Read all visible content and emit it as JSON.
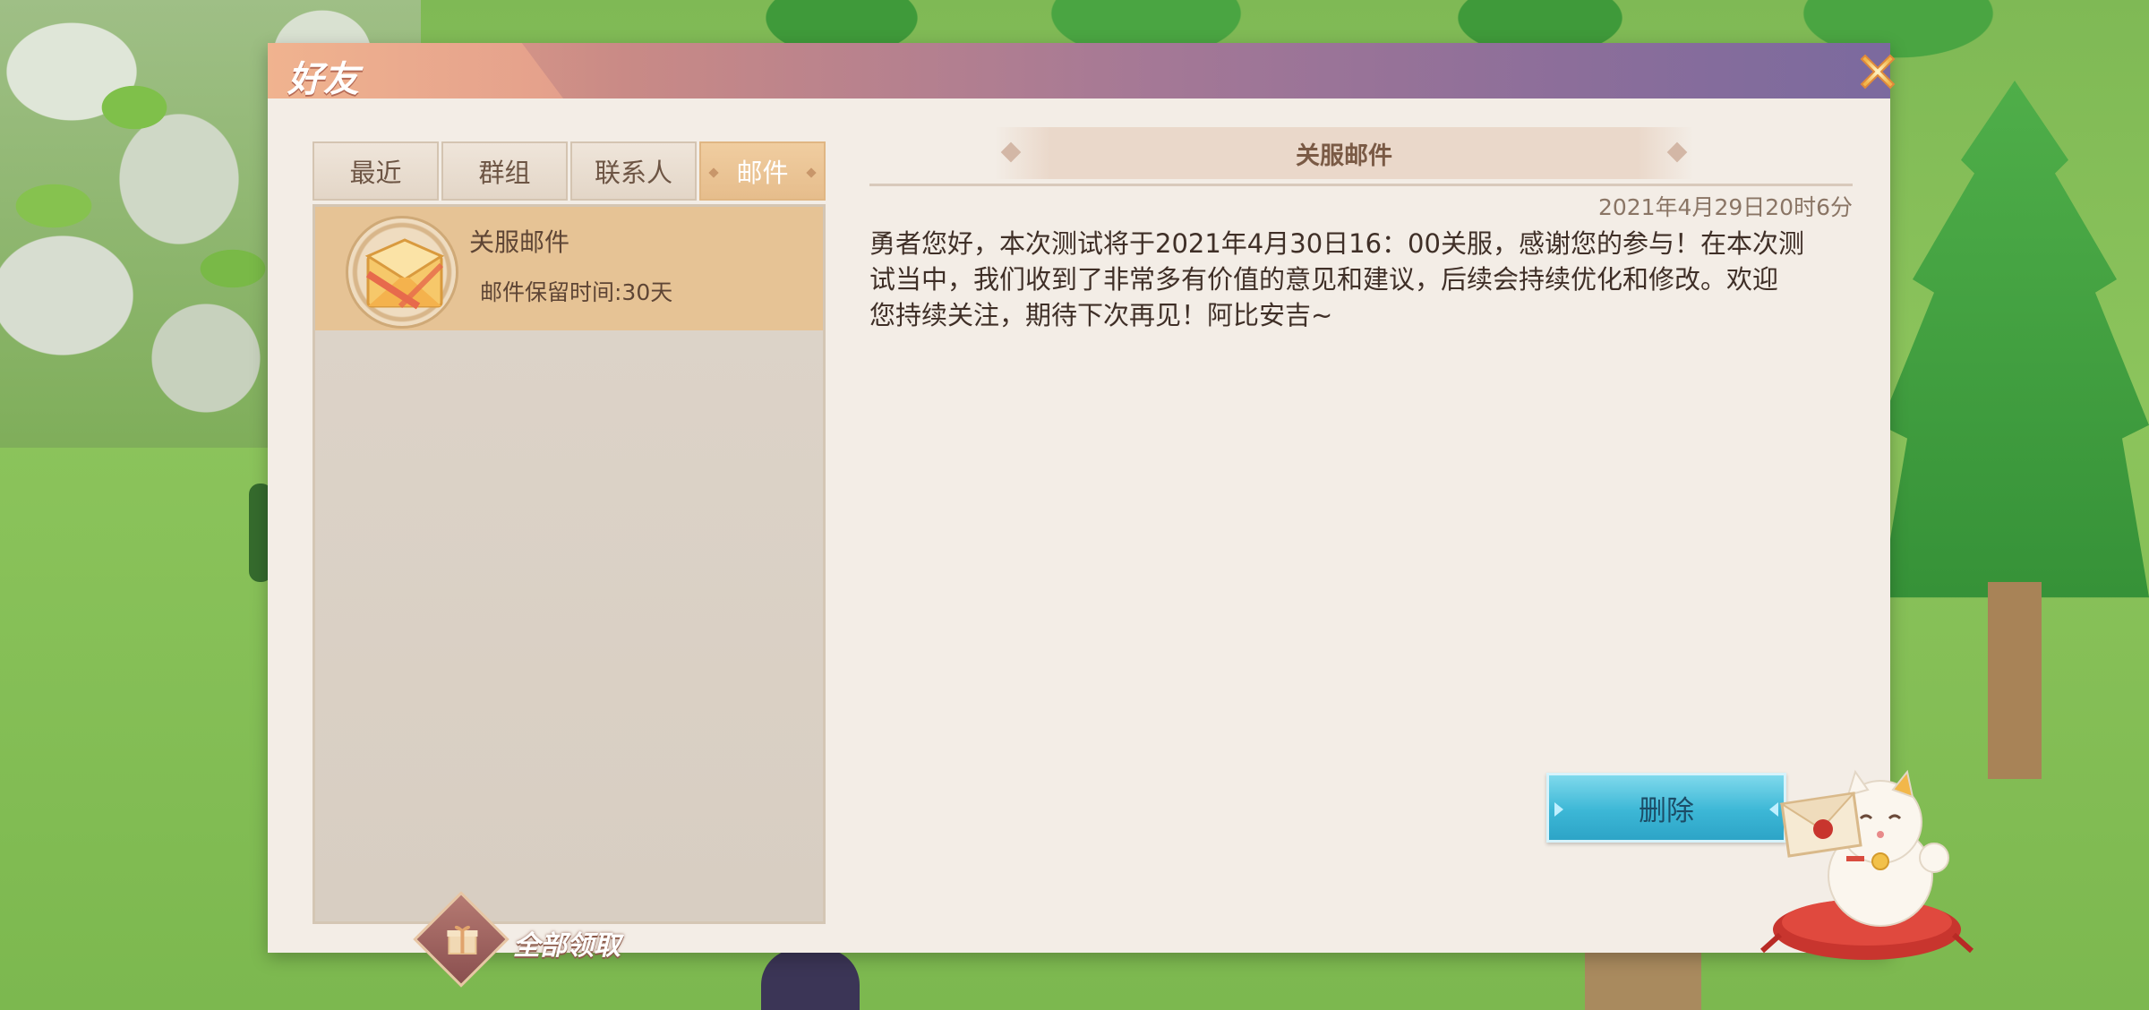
{
  "dialog": {
    "title": "好友",
    "close_icon": "close-x-icon"
  },
  "tabs": [
    {
      "label": "最近",
      "active": false
    },
    {
      "label": "群组",
      "active": false
    },
    {
      "label": "联系人",
      "active": false
    },
    {
      "label": "邮件",
      "active": true
    }
  ],
  "mail_list": {
    "items": [
      {
        "subject": "关服邮件",
        "retention": "邮件保留时间:30天",
        "icon": "envelope-icon",
        "selected": true
      }
    ],
    "claim_all_label": "全部领取",
    "claim_all_icon": "gift-icon"
  },
  "mail_detail": {
    "title": "关服邮件",
    "date": "2021年4月29日20时6分",
    "body_lines": [
      "勇者您好，本次测试将于2021年4月30日16：00关服，感谢您的参与！在本次测",
      "试当中，我们收到了非常多有价值的意见和建议，后续会持续优化和修改。欢迎",
      "您持续关注，期待下次再见！阿比安吉~"
    ],
    "delete_label": "删除"
  },
  "colors": {
    "header_gradient_start": "#e9a98a",
    "header_gradient_end": "#7b6a9e",
    "active_tab": "#e6bd8c",
    "selected_item": "#e6c395",
    "delete_button": "#3cb7d6",
    "panel_bg": "#f3ede6"
  }
}
